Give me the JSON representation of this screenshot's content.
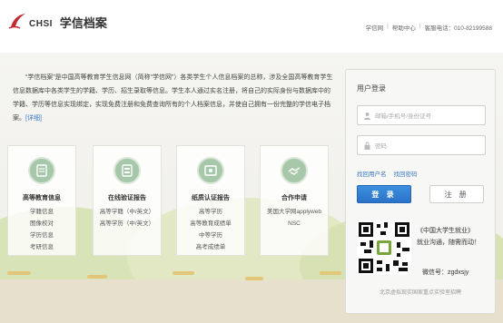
{
  "header": {
    "brand_mark": "CHSI",
    "brand_name": "学信档案",
    "links": [
      "学信网",
      "帮助中心",
      "客服电话：010-82199588"
    ]
  },
  "intro": {
    "text": "“学信档案”是中国高等教育学生信息网（简称“学信网”）各类学生个人信息档案的总称，涉及全国高等教育学生信息数据库中各类学生的学籍、学历、招生录取等信息。学生本人通过实名注册，将自己的实际身份与数据库中的学籍、学历等信息实现绑定，实现免费注册和免费查询所有的个人档案信息，并使自己拥有一份完整的学信电子档案。",
    "more": "[详细]"
  },
  "cards": [
    {
      "icon": "archive-icon",
      "title": "高等教育信息",
      "items": [
        "学籍信息",
        "图像校对",
        "学历信息",
        "考研信息"
      ]
    },
    {
      "icon": "report-icon",
      "title": "在线验证报告",
      "items": [
        "高等学籍（中/英文）",
        "高等学历（中/英文）"
      ]
    },
    {
      "icon": "certificate-icon",
      "title": "纸质认证报告",
      "items": [
        "高等学历",
        "高等教育成绩单",
        "中等学历",
        "高考成绩单"
      ]
    },
    {
      "icon": "handshake-icon",
      "title": "合作申请",
      "items": [
        "美国大学网applyweb",
        "NSC"
      ]
    }
  ],
  "login": {
    "title": "用户登录",
    "username_placeholder": "邮箱/手机号/身份证号",
    "password_placeholder": "密码",
    "forgot_username": "找回用户名",
    "forgot_password": "找回密码",
    "login_button": "登 录",
    "register_button": "注 册",
    "wechat_title": "《中国大学生就业》",
    "wechat_slogan": "就业沟通，随需而动！",
    "wechat_id": "微信号：zgdxsjy",
    "footer": "北京虚拟现实国家重点实验室招聘"
  },
  "colors": {
    "accent_blue": "#2a72c8",
    "logo_red": "#c8282d",
    "card_icon_green": "#a6c7a9"
  }
}
